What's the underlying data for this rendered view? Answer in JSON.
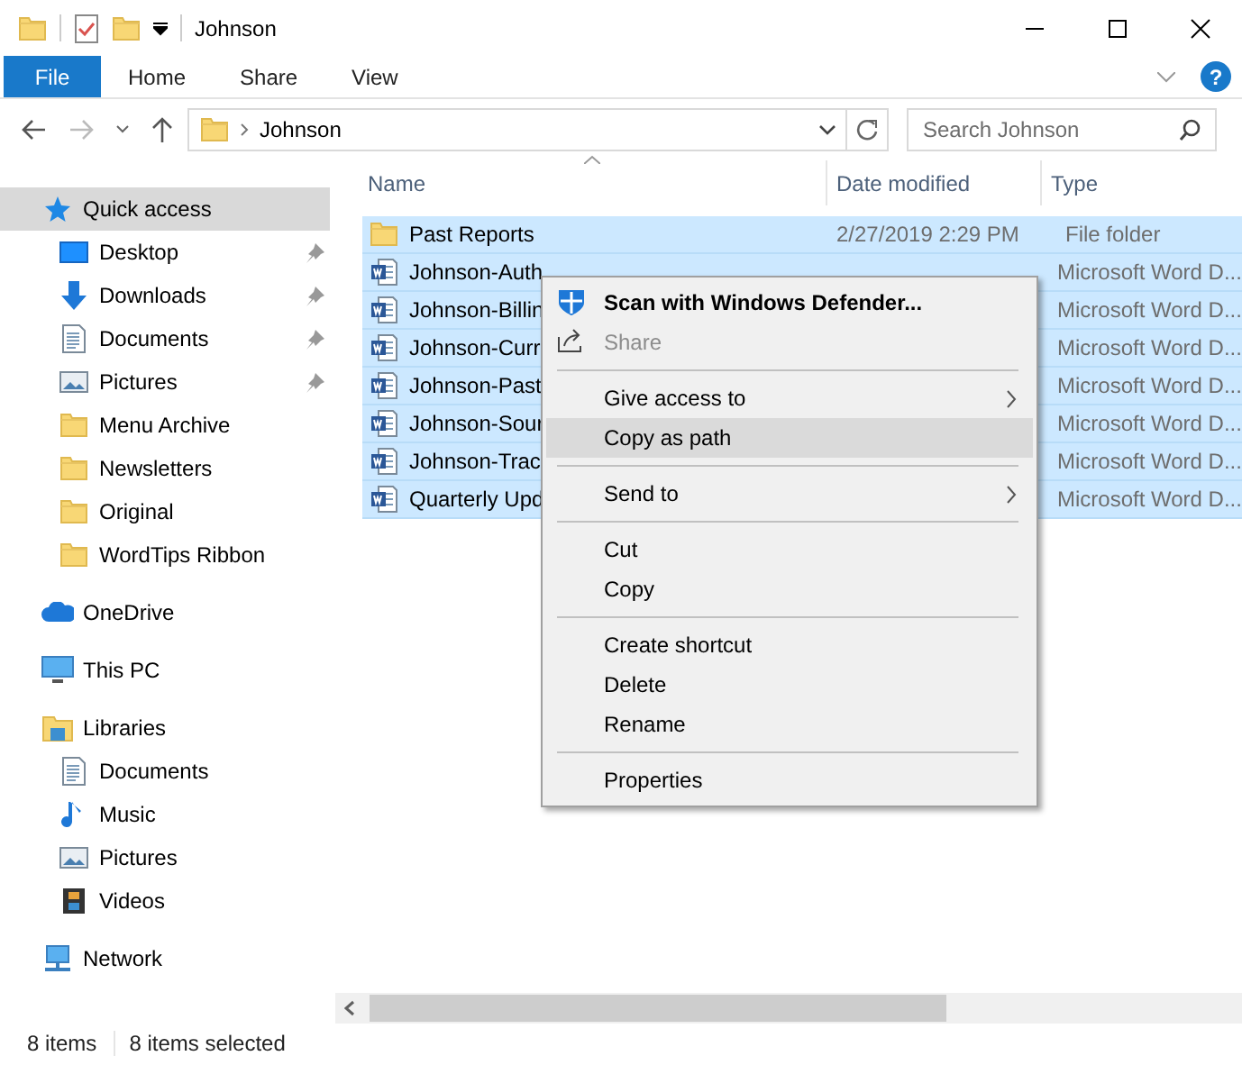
{
  "window": {
    "title": "Johnson"
  },
  "ribbon": {
    "tabs": [
      {
        "label": "File",
        "kind": "file",
        "selected": false
      },
      {
        "label": "Home",
        "kind": "tab",
        "selected": false
      },
      {
        "label": "Share",
        "kind": "tab",
        "selected": false
      },
      {
        "label": "View",
        "kind": "tab",
        "selected": false
      }
    ],
    "help": "?"
  },
  "address_bar": {
    "path": [
      "Johnson"
    ]
  },
  "search": {
    "placeholder": "Search Johnson"
  },
  "nav_pane": {
    "groups": [
      {
        "items": [
          {
            "label": "Quick access",
            "kind": "star",
            "selected": true,
            "children": [
              {
                "label": "Desktop",
                "kind": "desktop",
                "pinned": true,
                "selected": false
              },
              {
                "label": "Downloads",
                "kind": "download",
                "pinned": true,
                "selected": false
              },
              {
                "label": "Documents",
                "kind": "document",
                "pinned": true,
                "selected": false
              },
              {
                "label": "Pictures",
                "kind": "pictures",
                "pinned": true,
                "selected": false
              },
              {
                "label": "Menu Archive",
                "kind": "folder",
                "pinned": false,
                "selected": false
              },
              {
                "label": "Newsletters",
                "kind": "folder",
                "pinned": false,
                "selected": false
              },
              {
                "label": "Original",
                "kind": "folder",
                "pinned": false,
                "selected": false
              },
              {
                "label": "WordTips Ribbon",
                "kind": "folder",
                "pinned": false,
                "selected": false
              }
            ]
          }
        ]
      },
      {
        "items": [
          {
            "label": "OneDrive",
            "kind": "cloud",
            "selected": false
          }
        ]
      },
      {
        "items": [
          {
            "label": "This PC",
            "kind": "pc",
            "selected": false
          }
        ]
      },
      {
        "items": [
          {
            "label": "Libraries",
            "kind": "libraries",
            "selected": false,
            "children": [
              {
                "label": "Documents",
                "kind": "document",
                "selected": false
              },
              {
                "label": "Music",
                "kind": "music",
                "selected": false
              },
              {
                "label": "Pictures",
                "kind": "pictures",
                "selected": false
              },
              {
                "label": "Videos",
                "kind": "video",
                "selected": false
              }
            ]
          }
        ]
      },
      {
        "items": [
          {
            "label": "Network",
            "kind": "network",
            "selected": false
          }
        ]
      }
    ]
  },
  "file_list": {
    "columns": [
      {
        "label": "Name",
        "sorted": true
      },
      {
        "label": "Date modified",
        "sorted": false
      },
      {
        "label": "Type",
        "sorted": false
      }
    ],
    "rows": [
      {
        "name": "Past Reports",
        "date": "2/27/2019 2:29 PM",
        "type": "File folder",
        "kind": "folder",
        "selected": true
      },
      {
        "name": "Johnson-Auth",
        "type": "Microsoft Word D...",
        "kind": "word",
        "selected": true
      },
      {
        "name": "Johnson-Billin",
        "type": "Microsoft Word D...",
        "kind": "word",
        "selected": true
      },
      {
        "name": "Johnson-Curr",
        "type": "Microsoft Word D...",
        "kind": "word",
        "selected": true
      },
      {
        "name": "Johnson-Past",
        "type": "Microsoft Word D...",
        "kind": "word",
        "selected": true
      },
      {
        "name": "Johnson-Sour",
        "type": "Microsoft Word D...",
        "kind": "word",
        "selected": true
      },
      {
        "name": "Johnson-Trac",
        "type": "Microsoft Word D...",
        "kind": "word",
        "selected": true
      },
      {
        "name": "Quarterly Upd",
        "type": "Microsoft Word D...",
        "kind": "word",
        "selected": true
      }
    ]
  },
  "context_menu": {
    "items": [
      {
        "kind": "defender",
        "label": "Scan with Windows Defender...",
        "bold": true,
        "disabled": false,
        "submenu": false,
        "selected": false
      },
      {
        "kind": "share",
        "label": "Share",
        "bold": false,
        "disabled": true,
        "submenu": false,
        "selected": false
      },
      {
        "kind": "separator"
      },
      {
        "kind": "item",
        "label": "Give access to",
        "bold": false,
        "disabled": false,
        "submenu": true,
        "selected": false
      },
      {
        "kind": "item",
        "label": "Copy as path",
        "bold": false,
        "disabled": false,
        "submenu": false,
        "selected": true
      },
      {
        "kind": "separator"
      },
      {
        "kind": "item",
        "label": "Send to",
        "bold": false,
        "disabled": false,
        "submenu": true,
        "selected": false
      },
      {
        "kind": "separator"
      },
      {
        "kind": "item",
        "label": "Cut",
        "bold": false,
        "disabled": false,
        "submenu": false,
        "selected": false
      },
      {
        "kind": "item",
        "label": "Copy",
        "bold": false,
        "disabled": false,
        "submenu": false,
        "selected": false
      },
      {
        "kind": "separator"
      },
      {
        "kind": "item",
        "label": "Create shortcut",
        "bold": false,
        "disabled": false,
        "submenu": false,
        "selected": false
      },
      {
        "kind": "item",
        "label": "Delete",
        "bold": false,
        "disabled": false,
        "submenu": false,
        "selected": false
      },
      {
        "kind": "item",
        "label": "Rename",
        "bold": false,
        "disabled": false,
        "submenu": false,
        "selected": false
      },
      {
        "kind": "separator"
      },
      {
        "kind": "item",
        "label": "Properties",
        "bold": false,
        "disabled": false,
        "submenu": false,
        "selected": false
      }
    ]
  },
  "status_bar": {
    "item_count": "8 items",
    "selection": "8 items selected"
  }
}
